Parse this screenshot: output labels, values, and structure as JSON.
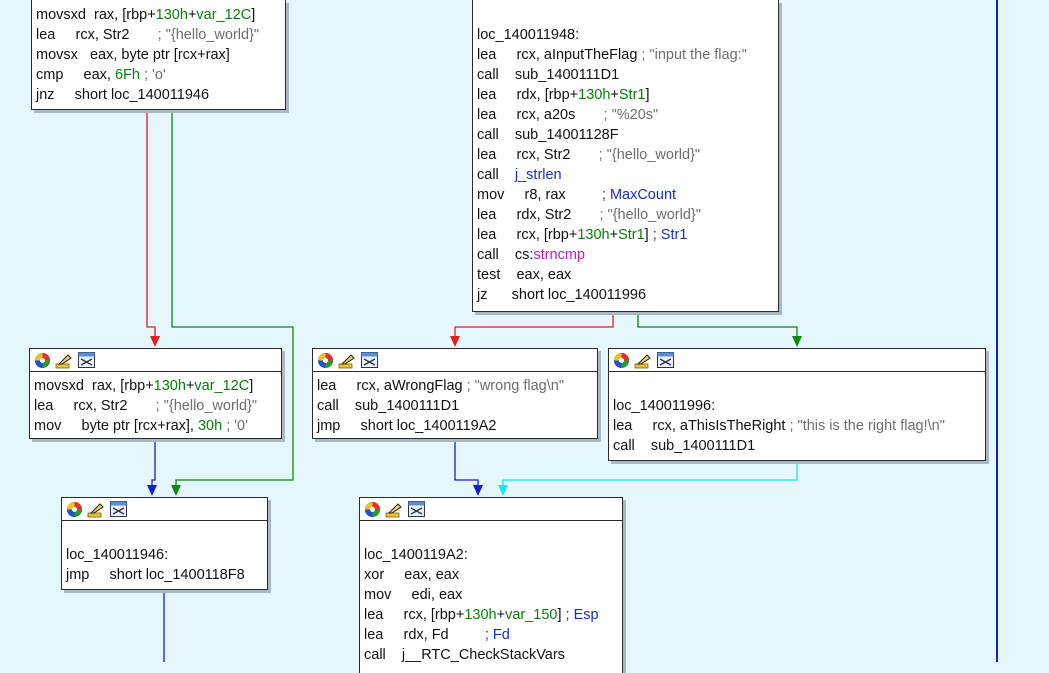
{
  "nodes": {
    "n1": {
      "lines": [
        [
          "movsxd  rax, [rbp+",
          "130h",
          "+",
          "var_12C",
          "]"
        ],
        [
          "lea     rcx, Str2       ",
          "; \"{hello_world}\""
        ],
        [
          "movsx   eax, byte ptr [rcx+rax]"
        ],
        [
          "cmp     eax, ",
          "6Fh",
          " ",
          "; 'o'"
        ],
        [
          "jnz     short loc_140011946"
        ]
      ]
    },
    "n2": {
      "label": "loc_140011948:",
      "lines": [
        [
          "lea     rcx, aInputTheFlag ",
          "; \"input the flag:\""
        ],
        [
          "call    sub_1400111D1"
        ],
        [
          "lea     rdx, [rbp+",
          "130h",
          "+",
          "Str1",
          "]"
        ],
        [
          "lea     rcx, a20s       ",
          "; \"%20s\""
        ],
        [
          "call    sub_14001128F"
        ],
        [
          "lea     rcx, Str2       ",
          "; \"{hello_world}\""
        ],
        [
          "call    ",
          "j_strlen"
        ],
        [
          "mov     r8, rax         ",
          "; MaxCount"
        ],
        [
          "lea     rdx, Str2       ",
          "; \"{hello_world}\""
        ],
        [
          "lea     rcx, [rbp+",
          "130h",
          "+",
          "Str1",
          "] ",
          "; Str1"
        ],
        [
          "call    cs:",
          "strncmp"
        ],
        [
          "test    eax, eax"
        ],
        [
          "jz      short loc_140011996"
        ]
      ]
    },
    "n3": {
      "lines": [
        [
          "movsxd  rax, [rbp+",
          "130h",
          "+",
          "var_12C",
          "]"
        ],
        [
          "lea     rcx, Str2       ",
          "; \"{hello_world}\""
        ],
        [
          "mov     byte ptr [rcx+rax], ",
          "30h",
          " ",
          "; '0'"
        ]
      ]
    },
    "n4": {
      "lines": [
        [
          "lea     rcx, aWrongFlag ",
          "; \"wrong flag\\n\""
        ],
        [
          "call    sub_1400111D1"
        ],
        [
          "jmp     short loc_1400119A2"
        ]
      ]
    },
    "n5": {
      "label": "loc_140011996:",
      "lines": [
        [
          "lea     rcx, aThisIsTheRight ",
          "; \"this is the right flag!\\n\""
        ],
        [
          "call    sub_1400111D1"
        ]
      ]
    },
    "n6": {
      "label": "loc_140011946:",
      "lines": [
        [
          "jmp     short loc_1400118F8"
        ]
      ]
    },
    "n7": {
      "label": "loc_1400119A2:",
      "lines": [
        [
          "xor     eax, eax"
        ],
        [
          "mov     edi, eax"
        ],
        [
          "lea     rcx, [rbp+",
          "130h",
          "+",
          "var_150",
          "] ",
          "; Esp"
        ],
        [
          "lea     rdx, Fd         ",
          "; Fd"
        ],
        [
          "call    j__RTC_CheckStackVars"
        ]
      ]
    }
  },
  "icons": [
    "color-palette-icon",
    "edit-node-icon",
    "graph-toggle-icon"
  ],
  "colors": {
    "background": "#e6f6fd",
    "edge_true": "#0a8a0a",
    "edge_false": "#e02020",
    "edge_uncond": "#1020d0",
    "edge_cyan": "#19e6ef"
  }
}
